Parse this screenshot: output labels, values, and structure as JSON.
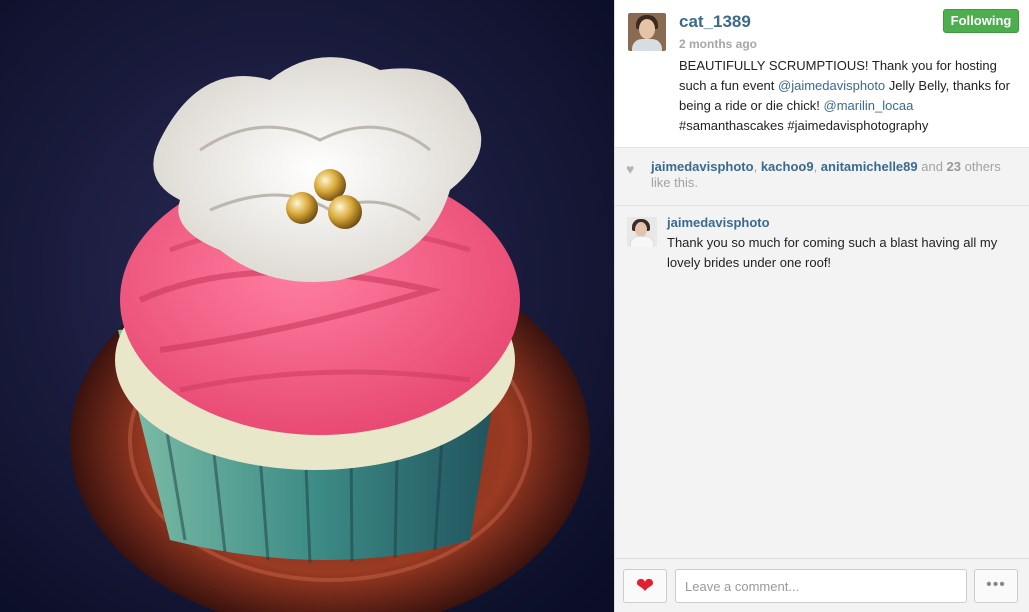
{
  "post": {
    "photo_description_icon": "cupcake-photo",
    "author": {
      "username": "cat_1389",
      "time_ago": "2 months ago"
    },
    "follow_button_label": "Following",
    "caption": {
      "part1": "BEAUTIFULLY SCRUMPTIOUS! Thank you for hosting such a fun event ",
      "mention1": "@jaimedavisphoto",
      "part2": " Jelly Belly, thanks for being a ride or die chick! ",
      "mention2": "@marilin_locaa",
      "part3": " #samanthascakes #jaimedavisphotography"
    }
  },
  "likes": {
    "heart_icon": "heart-icon",
    "user1": "jaimedavisphoto",
    "sep1": ", ",
    "user2": "kachoo9",
    "sep2": ", ",
    "user3": "anitamichelle89",
    "and_text": " and ",
    "count": "23",
    "others_text": " others like this."
  },
  "comments": [
    {
      "username": "jaimedavisphoto",
      "text": "Thank you so much for coming such a blast having all my lovely brides under one roof!"
    }
  ],
  "footer": {
    "like_button_icon": "heart-icon",
    "comment_placeholder": "Leave a comment...",
    "more_button_label": "•••"
  },
  "colors": {
    "link": "#3b6a8f",
    "follow_green": "#4cae4c",
    "like_red": "#e0212d"
  }
}
